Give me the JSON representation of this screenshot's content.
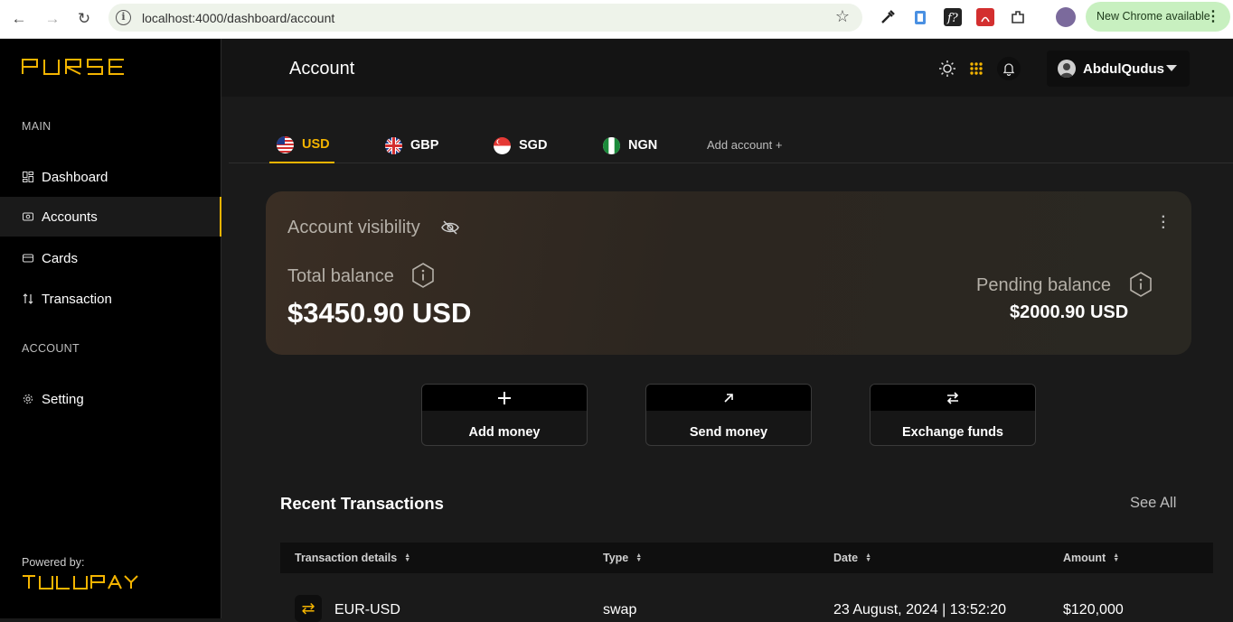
{
  "browser": {
    "url": "localhost:4000/dashboard/account",
    "update_label": "New Chrome available"
  },
  "sidebar": {
    "brand": "PURSE",
    "section_main": "MAIN",
    "section_account": "ACCOUNT",
    "items": [
      {
        "label": "Dashboard",
        "icon": "grid-icon"
      },
      {
        "label": "Accounts",
        "icon": "wallet-icon",
        "active": true
      },
      {
        "label": "Cards",
        "icon": "card-icon"
      },
      {
        "label": "Transaction",
        "icon": "sort-arrows-icon"
      },
      {
        "label": "Setting",
        "icon": "gear-icon"
      }
    ],
    "powered_by": "Powered by:",
    "partner": "TULUPAY"
  },
  "header": {
    "title": "Account",
    "user_name": "AbdulQudus"
  },
  "tabs": [
    {
      "label": "USD",
      "active": true
    },
    {
      "label": "GBP"
    },
    {
      "label": "SGD"
    },
    {
      "label": "NGN"
    }
  ],
  "add_account_label": "Add account +",
  "balance": {
    "visibility_label": "Account visibility",
    "total_label": "Total balance",
    "total_value": "$3450.90 USD",
    "pending_label": "Pending balance",
    "pending_value": "$2000.90 USD"
  },
  "actions": [
    {
      "label": "Add money",
      "icon": "plus-icon"
    },
    {
      "label": "Send money",
      "icon": "arrow-up-right-icon"
    },
    {
      "label": "Exchange funds",
      "icon": "exchange-icon"
    }
  ],
  "recent": {
    "title": "Recent Transactions",
    "see_all": "See All",
    "columns": [
      "Transaction details",
      "Type",
      "Date",
      "Amount"
    ],
    "rows": [
      {
        "details": "EUR-USD",
        "type": "swap",
        "date": "23 August, 2024 | 13:52:20",
        "amount": "$120,000"
      }
    ]
  },
  "colors": {
    "accent": "#f4b400",
    "sidebar_bg": "#000000",
    "main_bg": "#1a1a1a"
  }
}
